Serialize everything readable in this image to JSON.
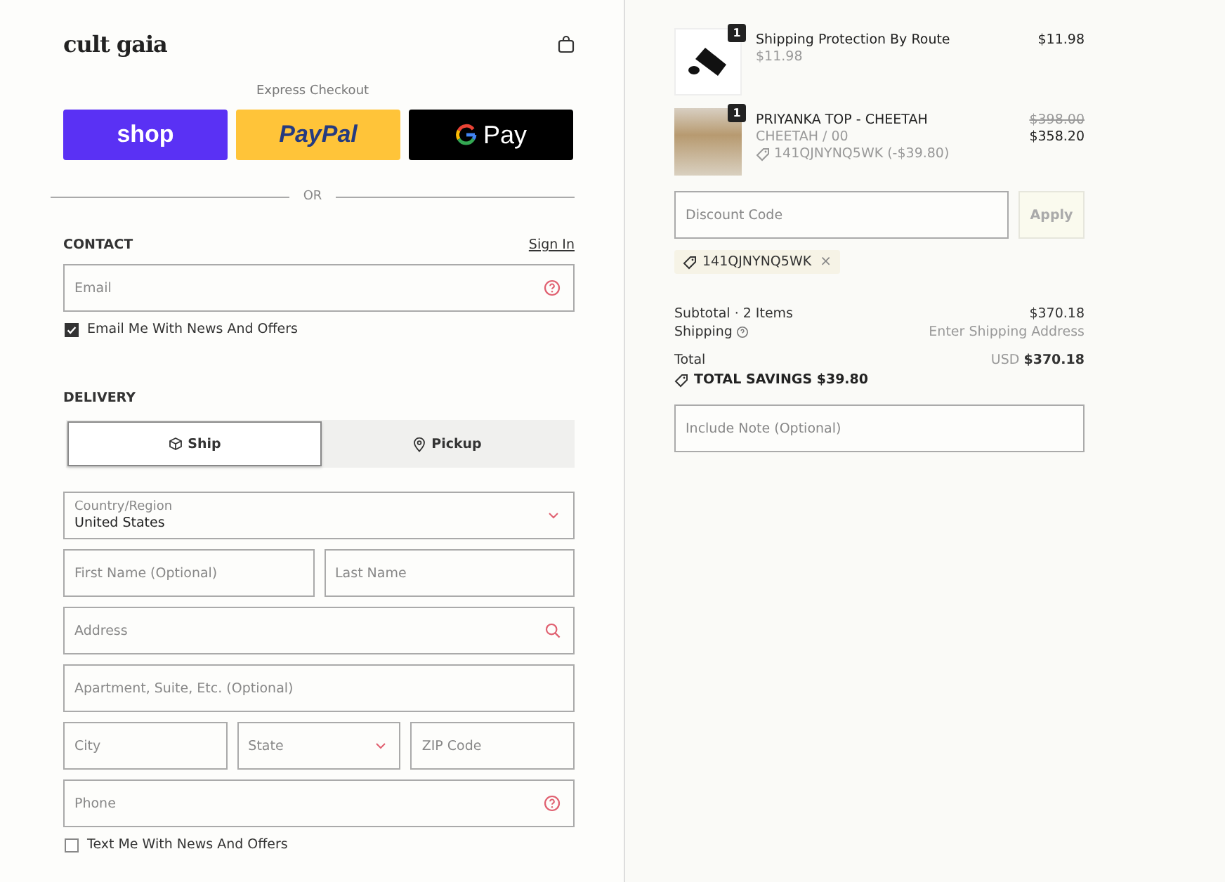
{
  "header": {
    "logo": "cult gaia"
  },
  "express": {
    "label": "Express Checkout",
    "buttons": [
      {
        "kind": "shop",
        "label": "shop"
      },
      {
        "kind": "paypal",
        "label": "PayPal"
      },
      {
        "kind": "gpay",
        "label": "Pay"
      }
    ],
    "divider": "OR"
  },
  "contact": {
    "title": "CONTACT",
    "link": "Sign In",
    "email": {
      "placeholder": "Email"
    },
    "newsletter": {
      "label": "Email Me With News And Offers",
      "checked": true
    }
  },
  "delivery": {
    "title": "DELIVERY",
    "tabs": [
      {
        "label": "Ship",
        "kind": "ship",
        "selected": true
      },
      {
        "label": "Pickup",
        "kind": "pickup",
        "selected": false
      }
    ],
    "rows": [
      [
        {
          "kind": "select",
          "label": "Country/Region",
          "value": "United States"
        }
      ],
      [
        {
          "kind": "text",
          "placeholder": "First Name (Optional)"
        },
        {
          "kind": "text",
          "placeholder": "Last Name"
        }
      ],
      [
        {
          "kind": "search",
          "placeholder": "Address"
        }
      ],
      [
        {
          "kind": "text",
          "placeholder": "Apartment, Suite, Etc. (Optional)"
        }
      ],
      [
        {
          "kind": "text",
          "placeholder": "City"
        },
        {
          "kind": "dropdown",
          "placeholder": "State"
        },
        {
          "kind": "text",
          "placeholder": "ZIP Code"
        }
      ],
      [
        {
          "kind": "help",
          "placeholder": "Phone"
        }
      ]
    ],
    "sms": {
      "label": "Text Me With News And Offers",
      "checked": false
    }
  },
  "cart": {
    "items": [
      {
        "kind": "logo",
        "quantity": "1",
        "name": "Shipping Protection By Route",
        "variant": "$11.98",
        "price": "$11.98"
      },
      {
        "kind": "photo",
        "quantity": "1",
        "name": "PRIYANKA TOP - CHEETAH",
        "variant": "CHEETAH / 00",
        "discount": "141QJNYNQ5WK (-$39.80)",
        "old_price": "$398.00",
        "price": "$358.20"
      }
    ],
    "discount": {
      "placeholder": "Discount Code",
      "button": "Apply",
      "applied": "141QJNYNQ5WK",
      "remove": "×"
    },
    "subtotal": {
      "label": "Subtotal · 2 Items",
      "value": "$370.18"
    },
    "shipping": {
      "label": "Shipping",
      "value": "Enter Shipping Address"
    },
    "total": {
      "label": "Total",
      "currency": "USD",
      "value": "$370.18"
    },
    "savings": "TOTAL SAVINGS $39.80",
    "note": {
      "placeholder": "Include Note (Optional)"
    }
  }
}
